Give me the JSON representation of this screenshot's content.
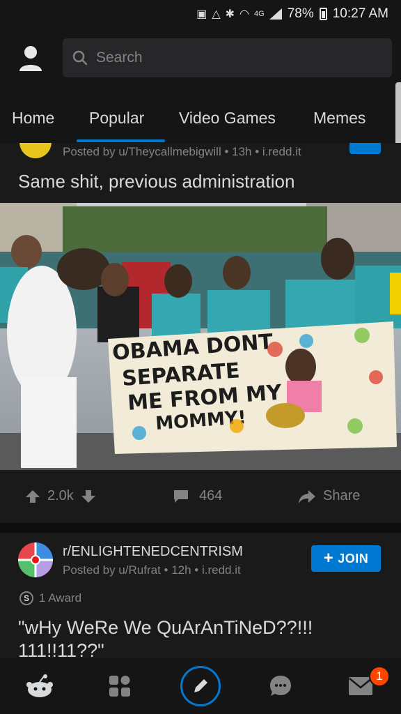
{
  "status_bar": {
    "battery": "78%",
    "time": "10:27 AM",
    "network": "4G"
  },
  "search": {
    "placeholder": "Search"
  },
  "tabs": [
    "Home",
    "Popular",
    "Video Games",
    "Memes"
  ],
  "active_tab": "Popular",
  "colors": {
    "accent": "#0079d3",
    "background": "#1a1a1b",
    "badge": "#ff4500"
  },
  "post1": {
    "meta": "Posted by u/Theycallmebigwill • 13h • i.redd.it",
    "title": "Same shit, previous administration",
    "image_sign_lines": [
      "OBAMA DONT",
      "SEPARATE",
      "ME FROM MY",
      "MOMMY!"
    ],
    "upvotes": "2.0k",
    "comments": "464",
    "share_label": "Share"
  },
  "post2": {
    "subreddit": "r/ENLIGHTENEDCENTRISM",
    "meta": "Posted by u/Rufrat • 12h • i.redd.it",
    "join_label": "JOIN",
    "awards": "1 Award",
    "title": "\"wHy WeRe We QuArAnTiNeD??!!! 111!!11??\""
  },
  "bottom_nav": {
    "items": [
      "home-icon",
      "communities-icon",
      "create-icon",
      "chat-icon",
      "inbox-icon"
    ],
    "inbox_badge": "1"
  }
}
